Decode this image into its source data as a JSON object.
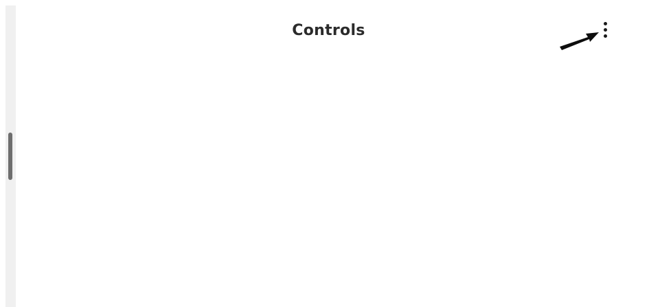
{
  "header": {
    "title": "Controls",
    "more_menu_icon": "more-vertical-icon",
    "annotation_icon": "arrow-pointer-icon"
  },
  "scrollbar": {
    "thumb_color": "#6e6e6e",
    "track_color": "#f0f0f0"
  },
  "colors": {
    "background": "#ffffff",
    "title": "#2b2b2b",
    "icon": "#1a1a1a"
  }
}
